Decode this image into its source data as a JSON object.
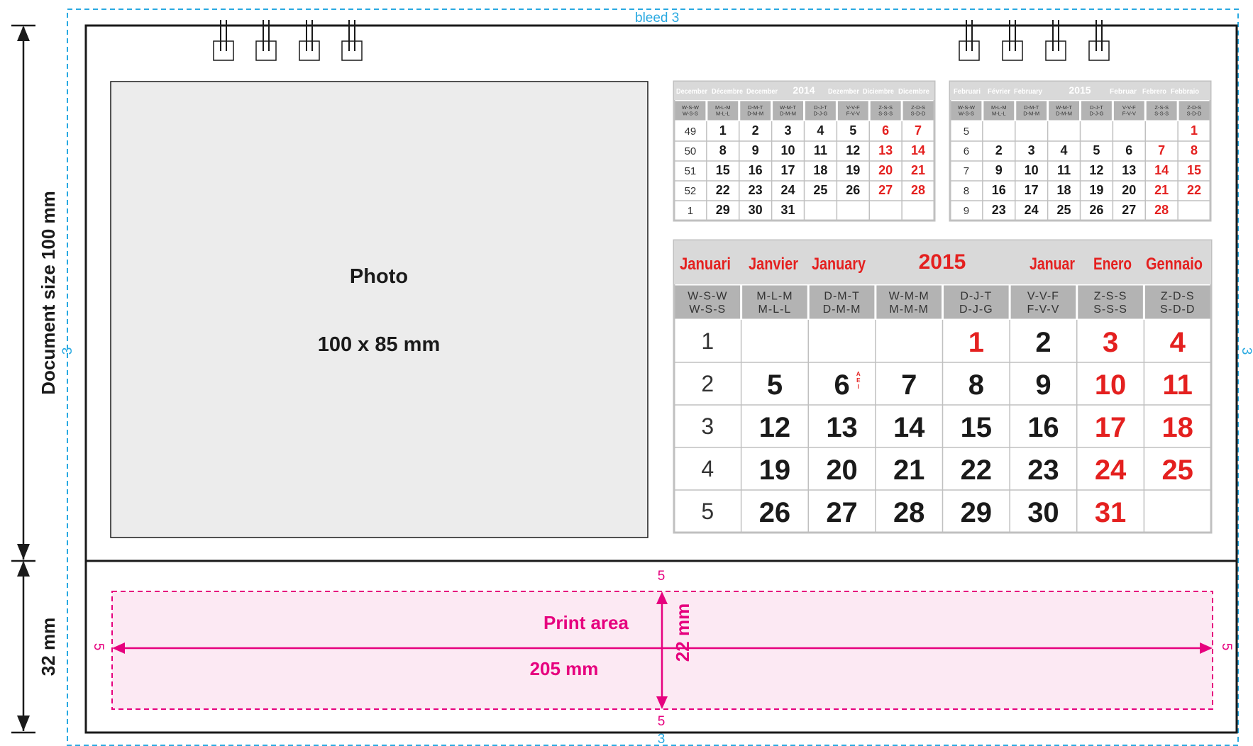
{
  "bleed_label": "bleed",
  "bleed_values": {
    "top": "3",
    "bottom": "3",
    "left": "3",
    "right": "3"
  },
  "doc_size_label": "Document size  100 mm",
  "base_size_label": "32 mm",
  "photo": {
    "label": "Photo",
    "size": "100 x 85 mm"
  },
  "print_area": {
    "label": "Print area",
    "width": "205  mm",
    "height": "22 mm",
    "margins": {
      "top": "5",
      "bottom": "5",
      "left": "5",
      "right": "5"
    }
  },
  "colors": {
    "bleed": "#29a9e1",
    "print": "#e6007e",
    "print_fill": "#fce9f3",
    "red": "#e4201f",
    "header_gray": "#d9d9d9",
    "dow_gray": "#b3b3b3",
    "border": "#c0c0c0",
    "photo_fill": "#ececec"
  },
  "calendars": [
    {
      "id": "dec-2014",
      "header": {
        "left": [
          "December",
          "Décembre",
          "December"
        ],
        "year": "2014",
        "right": [
          "Dezember",
          "Diciembre",
          "Dicembre"
        ]
      },
      "dow": [
        [
          "W-S-W",
          "W-S-S"
        ],
        [
          "M-L-M",
          "M-L-L"
        ],
        [
          "D-M-T",
          "D-M-M"
        ],
        [
          "W-M-T",
          "D-M-M"
        ],
        [
          "D-J-T",
          "D-J-G"
        ],
        [
          "V-V-F",
          "F-V-V"
        ],
        [
          "Z-S-S",
          "S-S-S"
        ],
        [
          "Z-D-S",
          "S-D-D"
        ]
      ],
      "weeks": [
        "49",
        "50",
        "51",
        "52",
        "1"
      ],
      "days": [
        [
          "1",
          "2",
          "3",
          "4",
          "5",
          "6",
          "7"
        ],
        [
          "8",
          "9",
          "10",
          "11",
          "12",
          "13",
          "14"
        ],
        [
          "15",
          "16",
          "17",
          "18",
          "19",
          "20",
          "21"
        ],
        [
          "22",
          "23",
          "24",
          "25",
          "26",
          "27",
          "28"
        ],
        [
          "29",
          "30",
          "31",
          "",
          "",
          "",
          ""
        ]
      ]
    },
    {
      "id": "feb-2015",
      "header": {
        "left": [
          "Februari",
          "Février",
          "February"
        ],
        "year": "2015",
        "right": [
          "Februar",
          "Febrero",
          "Febbraio"
        ]
      },
      "dow": [
        [
          "W-S-W",
          "W-S-S"
        ],
        [
          "M-L-M",
          "M-L-L"
        ],
        [
          "D-M-T",
          "D-M-M"
        ],
        [
          "W-M-T",
          "D-M-M"
        ],
        [
          "D-J-T",
          "D-J-G"
        ],
        [
          "V-V-F",
          "F-V-V"
        ],
        [
          "Z-S-S",
          "S-S-S"
        ],
        [
          "Z-D-S",
          "S-D-D"
        ]
      ],
      "weeks": [
        "5",
        "6",
        "7",
        "8",
        "9"
      ],
      "days": [
        [
          "",
          "",
          "",
          "",
          "",
          "",
          "1"
        ],
        [
          "2",
          "3",
          "4",
          "5",
          "6",
          "7",
          "8"
        ],
        [
          "9",
          "10",
          "11",
          "12",
          "13",
          "14",
          "15"
        ],
        [
          "16",
          "17",
          "18",
          "19",
          "20",
          "21",
          "22"
        ],
        [
          "23",
          "24",
          "25",
          "26",
          "27",
          "28",
          ""
        ]
      ]
    },
    {
      "id": "jan-2015",
      "header": {
        "left": [
          "Januari",
          "Janvier",
          "January"
        ],
        "year": "2015",
        "right": [
          "Januar",
          "Enero",
          "Gennaio"
        ]
      },
      "dow": [
        [
          "W-S-W",
          "W-S-S"
        ],
        [
          "M-L-M",
          "M-L-L"
        ],
        [
          "D-M-T",
          "D-M-M"
        ],
        [
          "W-M-M",
          "M-M-M"
        ],
        [
          "D-J-T",
          "D-J-G"
        ],
        [
          "V-V-F",
          "F-V-V"
        ],
        [
          "Z-S-S",
          "S-S-S"
        ],
        [
          "Z-D-S",
          "S-D-D"
        ]
      ],
      "weeks": [
        "1",
        "2",
        "3",
        "4",
        "5"
      ],
      "days": [
        [
          "",
          "",
          "",
          "1",
          "2",
          "3",
          "4"
        ],
        [
          "5",
          "6",
          "7",
          "8",
          "9",
          "10",
          "11"
        ],
        [
          "12",
          "13",
          "14",
          "15",
          "16",
          "17",
          "18"
        ],
        [
          "19",
          "20",
          "21",
          "22",
          "23",
          "24",
          "25"
        ],
        [
          "26",
          "27",
          "28",
          "29",
          "30",
          "31",
          ""
        ]
      ],
      "red_days": [
        "1",
        "3",
        "4",
        "10",
        "11",
        "17",
        "18",
        "24",
        "25",
        "31"
      ],
      "holiday_note": {
        "day": "6",
        "text": "AEI"
      }
    }
  ],
  "calendar_red_days": {
    "dec-2014": [
      "6",
      "7",
      "13",
      "14",
      "20",
      "21",
      "27",
      "28"
    ],
    "feb-2015": [
      "1",
      "7",
      "8",
      "14",
      "15",
      "21",
      "22",
      "28"
    ]
  }
}
